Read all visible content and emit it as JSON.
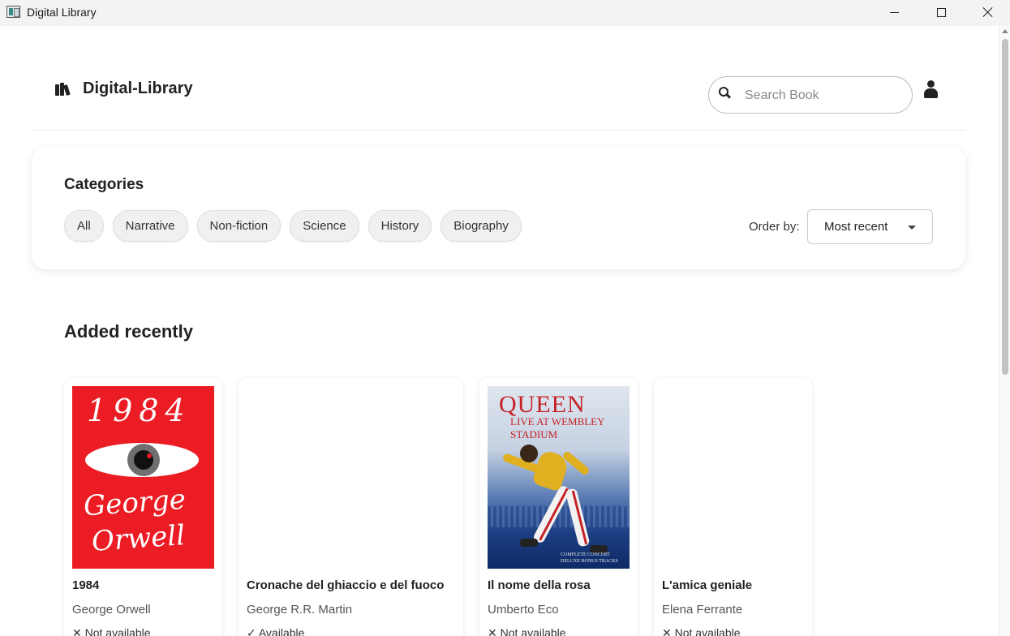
{
  "window": {
    "title": "Digital Library",
    "controls": [
      "minimize",
      "maximize",
      "close"
    ]
  },
  "header": {
    "brand_icon": "books-icon",
    "brand_title": "Digital-Library",
    "search_placeholder": "Search Book",
    "search_value": "",
    "user_icon": "user-icon"
  },
  "categories": {
    "title": "Categories",
    "chips": [
      "All",
      "Narrative",
      "Non-fiction",
      "Science",
      "History",
      "Biography"
    ],
    "order_label": "Order by:",
    "order_value": "Most recent"
  },
  "recent": {
    "title": "Added recently",
    "books": [
      {
        "title": "1984",
        "author": "George Orwell",
        "status": "✕ Not available",
        "cover": {
          "number": "1984",
          "author_line1": "George",
          "author_line2": "Orwell"
        }
      },
      {
        "title": "Cronache del ghiaccio e del fuoco",
        "author": "George R.R. Martin",
        "status": "✓ Available",
        "cover": null
      },
      {
        "title": "Il nome della rosa",
        "author": "Umberto Eco",
        "status": "✕ Not available",
        "cover": {
          "band": "QUEEN",
          "subtitle": "LIVE AT WEMBLEY STADIUM",
          "footer": "COMPLETE CONCERT DELUXE BONUS TRACKS"
        }
      },
      {
        "title": "L'amica geniale",
        "author": "Elena Ferrante",
        "status": "✕ Not available",
        "cover": null
      }
    ]
  },
  "colors": {
    "cover_1984_red": "#ec1c24",
    "queen_red": "#c52226",
    "chip_bg": "#f0f0f0"
  }
}
